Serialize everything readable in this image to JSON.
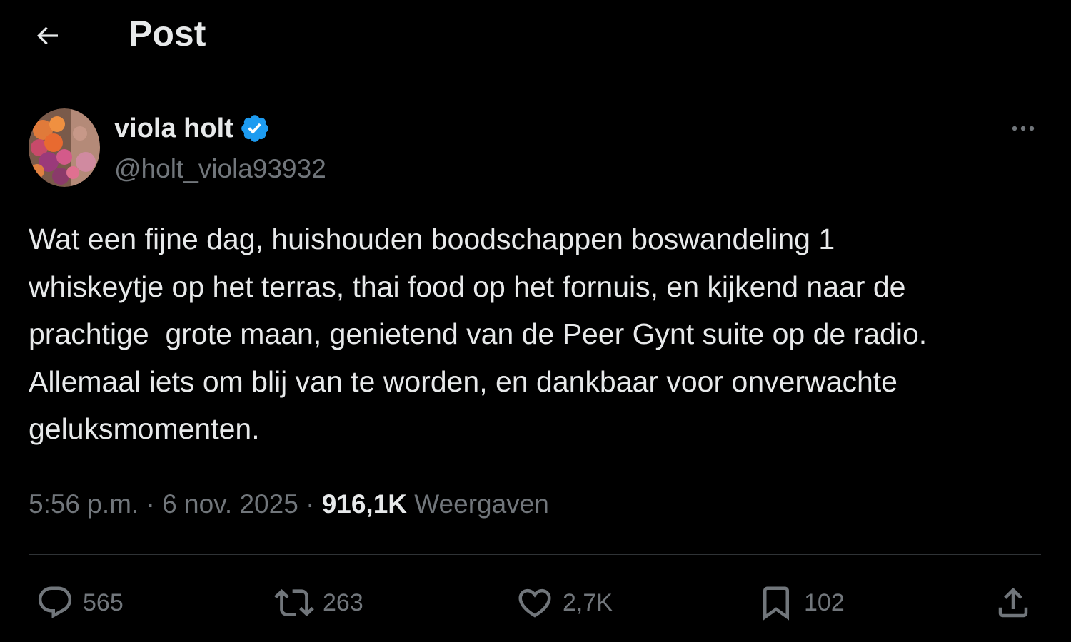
{
  "header": {
    "title": "Post"
  },
  "author": {
    "display_name": "viola holt",
    "handle": "@holt_viola93932",
    "verified": true
  },
  "post": {
    "text": "Wat een fijne dag, huishouden boodschappen boswandeling 1\nwhiskeytje op het terras, thai food op het fornuis, en kijkend naar de\nprachtige  grote maan, genietend van de Peer Gynt suite op de radio.\nAllemaal iets om blij van te worden, en dankbaar voor onverwachte\ngeluksmomenten.",
    "time": "5:56 p.m.",
    "separator": "·",
    "date": "6 nov. 2025",
    "views_count": "916,1K",
    "views_label": "Weergaven"
  },
  "actions": {
    "replies": "565",
    "reposts": "263",
    "likes": "2,7K",
    "bookmarks": "102"
  },
  "colors": {
    "background": "#000000",
    "text_primary": "#e7e9ea",
    "text_secondary": "#71767b",
    "divider": "#2f3336",
    "verified_blue": "#1d9bf0"
  },
  "icons": {
    "back": "arrow-left-icon",
    "verified": "verified-badge-icon",
    "more": "more-horizontal-icon",
    "reply": "reply-icon",
    "repost": "repost-icon",
    "like": "heart-icon",
    "bookmark": "bookmark-icon",
    "share": "share-icon"
  }
}
